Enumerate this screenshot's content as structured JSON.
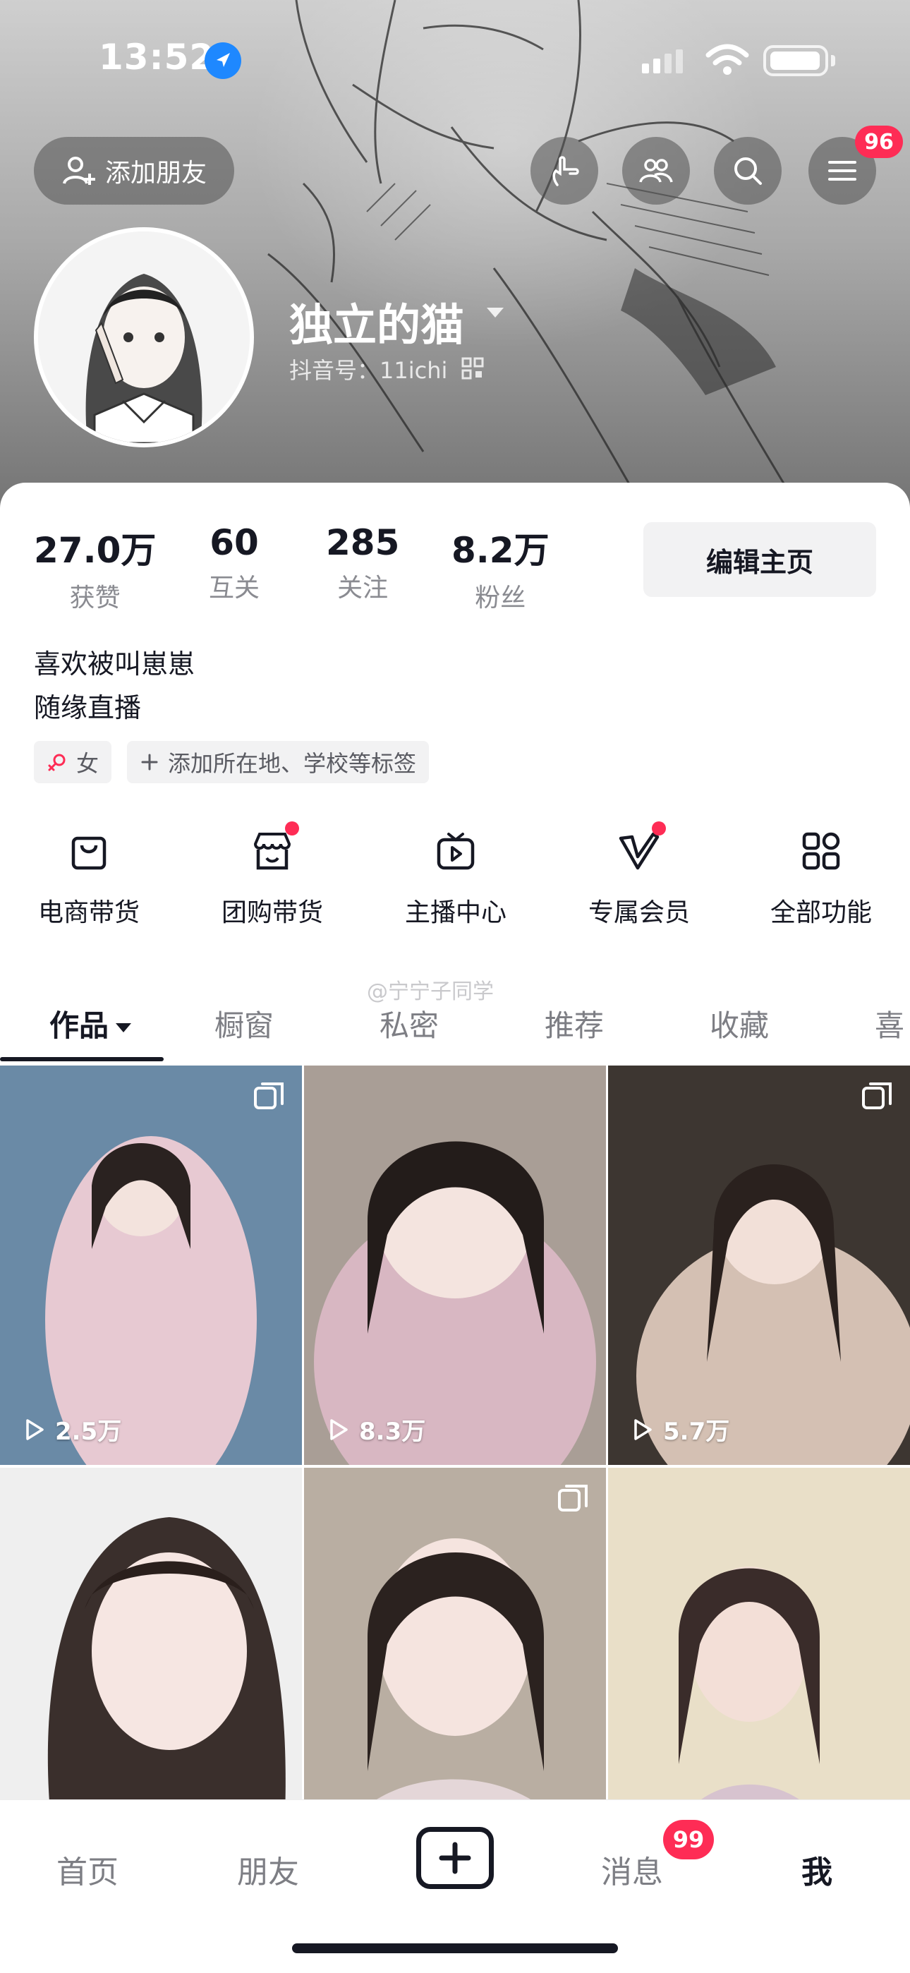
{
  "status_bar": {
    "time": "13:52"
  },
  "header": {
    "add_friend_label": "添加朋友",
    "menu_badge": "96"
  },
  "profile": {
    "nickname": "独立的猫",
    "douyin_id": "抖音号：11ichi"
  },
  "stats": [
    {
      "value": "27.0万",
      "label": "获赞"
    },
    {
      "value": "60",
      "label": "互关"
    },
    {
      "value": "285",
      "label": "关注"
    },
    {
      "value": "8.2万",
      "label": "粉丝"
    }
  ],
  "edit_button": "编辑主页",
  "bio": [
    "喜欢被叫崽崽",
    "随缘直播"
  ],
  "tags": {
    "gender": "女",
    "add": "添加所在地、学校等标签"
  },
  "features": [
    {
      "label": "电商带货",
      "icon": "shopping-bag-icon",
      "dot": false
    },
    {
      "label": "团购带货",
      "icon": "store-icon",
      "dot": true
    },
    {
      "label": "主播中心",
      "icon": "live-tv-icon",
      "dot": false
    },
    {
      "label": "专属会员",
      "icon": "vip-v-icon",
      "dot": true
    },
    {
      "label": "全部功能",
      "icon": "all-functions-icon",
      "dot": false
    }
  ],
  "tabs": [
    "作品",
    "橱窗",
    "私密",
    "推荐",
    "收藏",
    "喜"
  ],
  "watermark": "@宁宁子同学",
  "videos": [
    {
      "views": "2.5万",
      "multi": true,
      "colors": [
        "#6a8aa6",
        "#e7c9d2"
      ]
    },
    {
      "views": "8.3万",
      "multi": false,
      "colors": [
        "#a99e96",
        "#d8b7c2"
      ]
    },
    {
      "views": "5.7万",
      "multi": true,
      "colors": [
        "#3d3631",
        "#d4c0b3"
      ]
    },
    {
      "views": "",
      "multi": false,
      "colors": [
        "#efefef",
        "#3a2f2c"
      ]
    },
    {
      "views": "",
      "multi": true,
      "colors": [
        "#b9aea2",
        "#e4d6d8"
      ]
    },
    {
      "views": "",
      "multi": false,
      "colors": [
        "#e9dfc8",
        "#d7c3cf"
      ]
    }
  ],
  "bottom_nav": {
    "home": "首页",
    "friends": "朋友",
    "messages": "消息",
    "messages_badge": "99",
    "me": "我"
  },
  "theme": {
    "accent": "#fe2c55",
    "text": "#161823",
    "muted": "#8a8b91"
  }
}
